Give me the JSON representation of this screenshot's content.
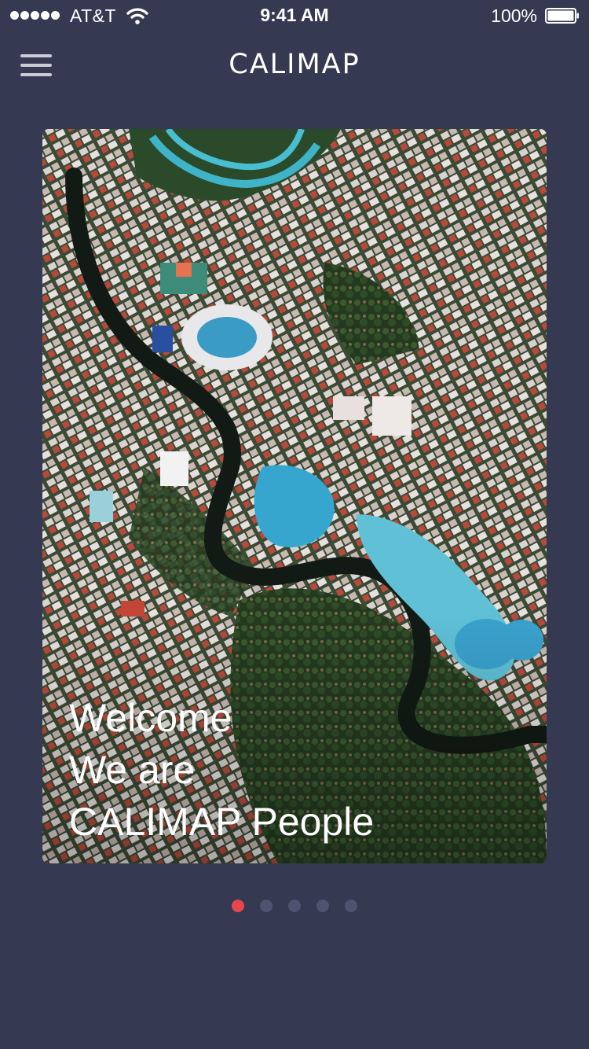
{
  "status_bar": {
    "carrier": "AT&T",
    "time": "9:41 AM",
    "battery_percent": "100%",
    "signal_bars": 5,
    "battery_level": 1.0
  },
  "nav": {
    "menu_icon": "hamburger-menu-icon",
    "logo_text": "CALIMAP"
  },
  "card": {
    "headline_lines": [
      "Welcome",
      "We are",
      "CALIMAP People"
    ],
    "image": "aerial-city-map-image"
  },
  "pagination": {
    "count": 5,
    "active_index": 0,
    "active_color": "#e8464f",
    "inactive_color": "#4d5370"
  },
  "colors": {
    "background": "#353a52",
    "text": "#ffffff"
  }
}
